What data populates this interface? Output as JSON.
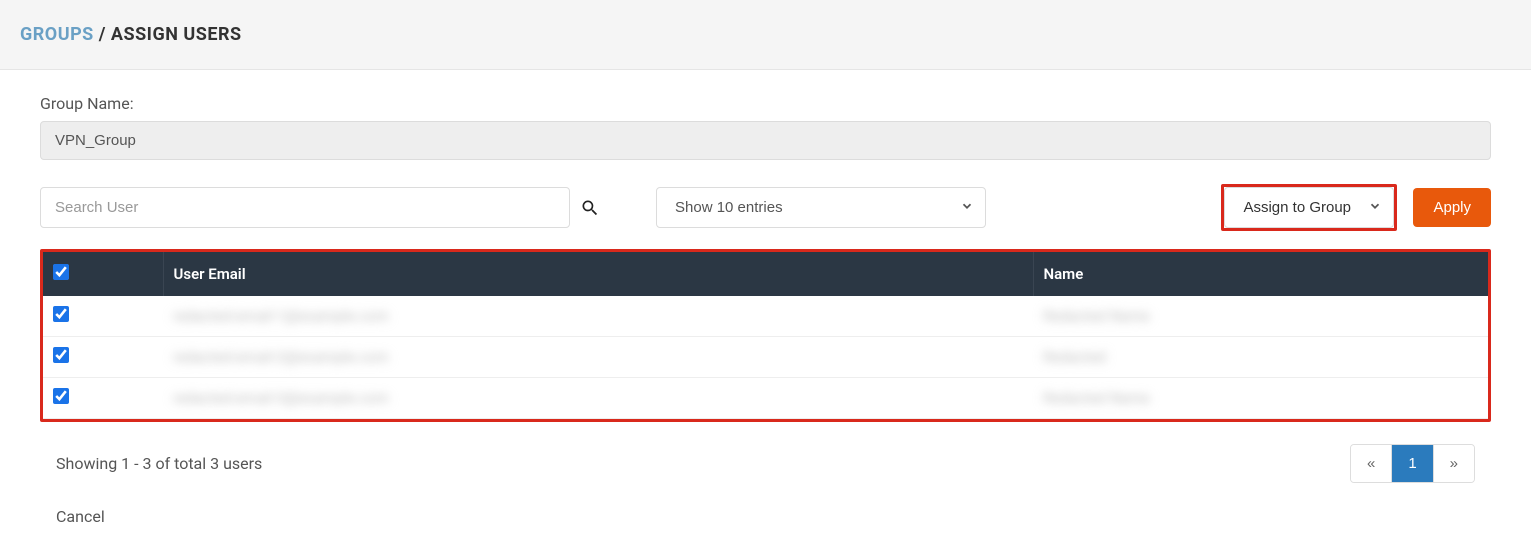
{
  "breadcrumb": {
    "root": "GROUPS",
    "separator": "/",
    "current": "ASSIGN USERS"
  },
  "group_name": {
    "label": "Group Name:",
    "value": "VPN_Group"
  },
  "search": {
    "placeholder": "Search User"
  },
  "entries_select": {
    "selected": "Show 10 entries"
  },
  "assign_select": {
    "selected": "Assign to Group"
  },
  "apply_label": "Apply",
  "table": {
    "headers": {
      "email": "User Email",
      "name": "Name"
    },
    "select_all": true,
    "rows": [
      {
        "checked": true,
        "email": "redacted-email-1@example.com",
        "name": "Redacted Name"
      },
      {
        "checked": true,
        "email": "redacted-email-2@example.com",
        "name": "Redacted"
      },
      {
        "checked": true,
        "email": "redacted-email-3@example.com",
        "name": "Redacted Name"
      }
    ]
  },
  "status_text": "Showing 1 - 3 of total 3 users",
  "pager": {
    "prev": "«",
    "current": "1",
    "next": "»"
  },
  "cancel_label": "Cancel"
}
